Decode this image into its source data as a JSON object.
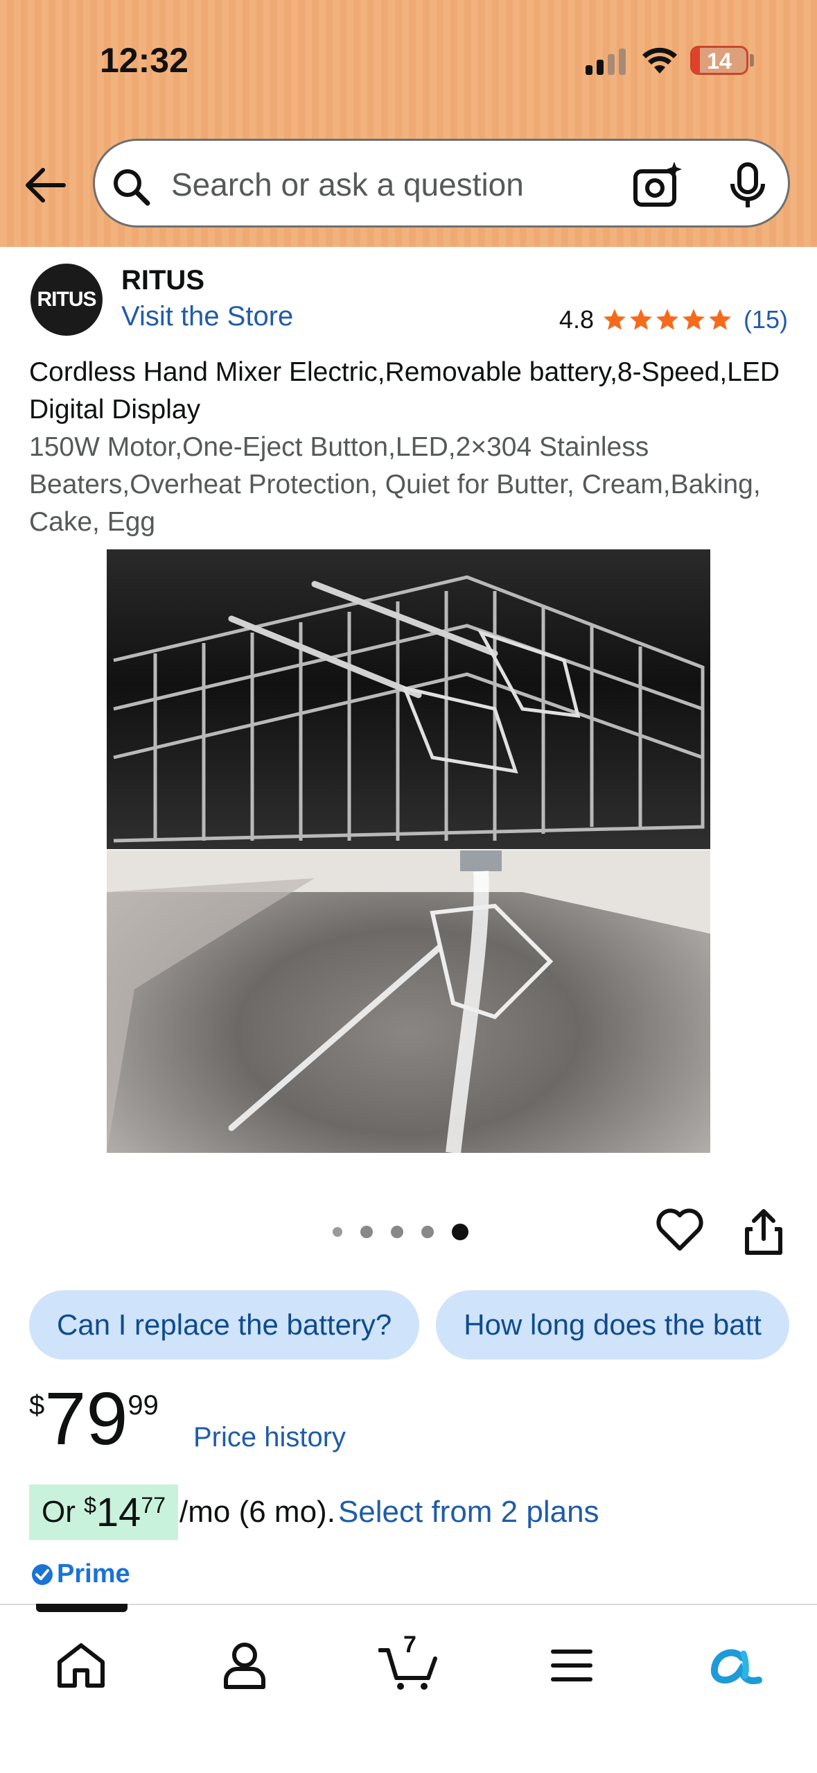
{
  "status_bar": {
    "time": "12:32",
    "battery": "14",
    "battery_level": 0.14
  },
  "search": {
    "placeholder": "Search or ask a question"
  },
  "brand": {
    "logo_text": "RITUS",
    "name": "RITUS",
    "visit_store": "Visit the Store"
  },
  "rating": {
    "value": "4.8",
    "stars": 5,
    "count": "(15)"
  },
  "product": {
    "title": "Cordless Hand Mixer Electric,Removable battery,8-Speed,LED Digital Display",
    "subtitle": "150W Motor,One-Eject Button,LED,2×304 Stainless Beaters,Overheat Protection, Quiet for Butter, Cream,Baking, Cake, Egg"
  },
  "carousel": {
    "total": 5,
    "active_index": 4
  },
  "questions": [
    "Can I replace the battery?",
    "How long does the batt"
  ],
  "price": {
    "symbol": "$",
    "whole": "79",
    "fraction": "99",
    "history_label": "Price history"
  },
  "monthly": {
    "prefix": "Or ",
    "symbol": "$",
    "whole": "14",
    "cents": "77",
    "suffix": "/mo (6 mo).",
    "link": "Select from 2 plans"
  },
  "prime": {
    "label": "Prime"
  },
  "nav": {
    "cart_count": "7"
  },
  "colors": {
    "header_bg": "#f2b27e",
    "link": "#1f5ca8",
    "star": "#f56a1b",
    "chip_bg": "#cfe3fb",
    "prime": "#1a73d6"
  }
}
